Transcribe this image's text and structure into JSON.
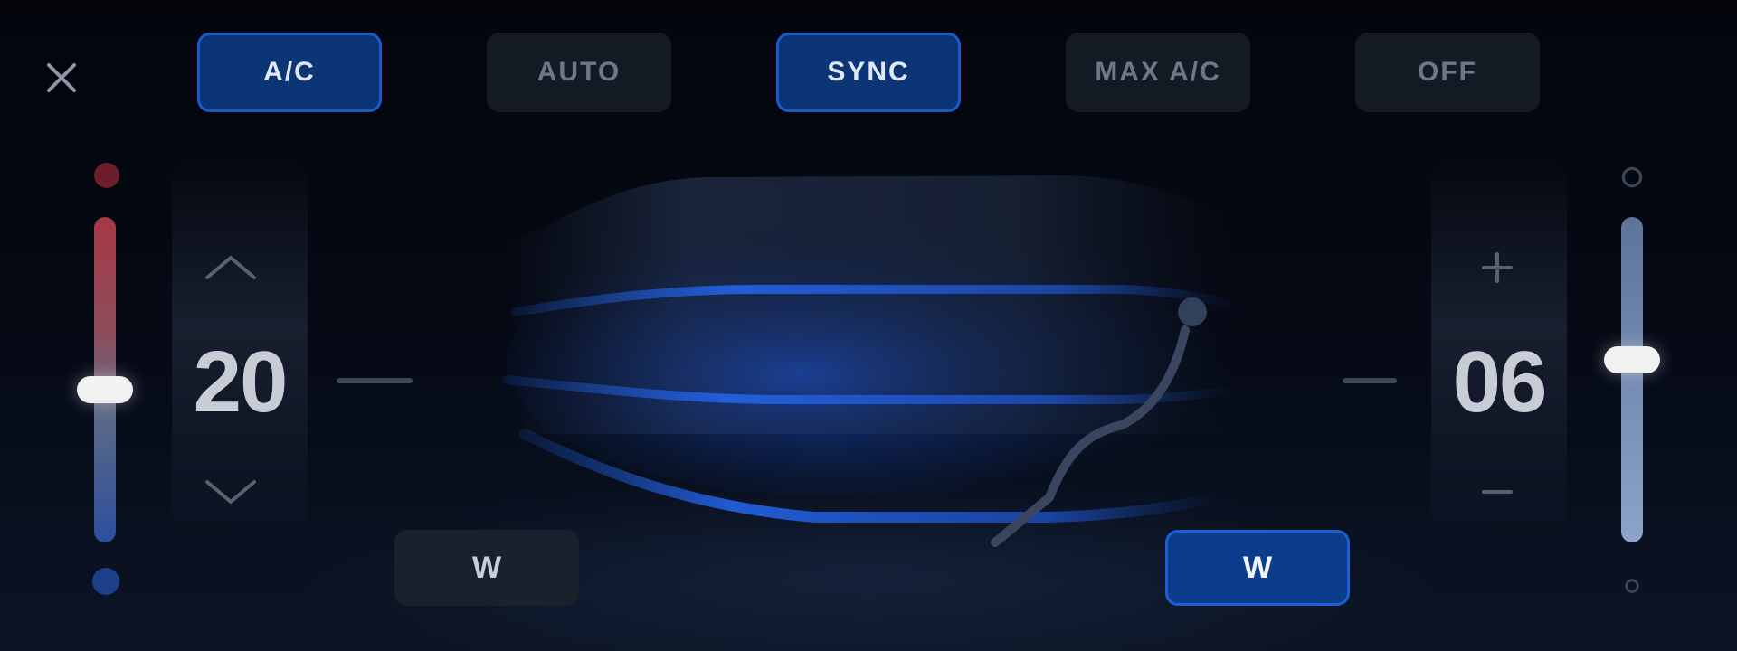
{
  "toolbar": {
    "close_icon": "close-icon",
    "modes": [
      {
        "id": "ac",
        "label": "A/C",
        "active": true
      },
      {
        "id": "auto",
        "label": "AUTO",
        "active": false
      },
      {
        "id": "sync",
        "label": "SYNC",
        "active": true
      },
      {
        "id": "max_ac",
        "label": "MAX A/C",
        "active": false
      },
      {
        "id": "off",
        "label": "OFF",
        "active": false
      }
    ]
  },
  "temperature": {
    "value": "20",
    "heat_icon": "heat-dot-icon",
    "cool_icon": "cool-dot-icon",
    "up_icon": "chevron-up-icon",
    "down_icon": "chevron-down-icon",
    "slider_level": 0.47
  },
  "fan": {
    "value": "06",
    "plus_icon": "plus-icon",
    "minus_icon": "minus-icon",
    "slider_level": 0.56
  },
  "airflow": {
    "icon": "airflow-visual",
    "seat_icon": "seat-occupant-icon"
  },
  "zones": [
    {
      "id": "zone_left",
      "label": "W",
      "active": false
    },
    {
      "id": "zone_right",
      "label": "W",
      "active": true
    }
  ],
  "colors": {
    "accent": "#1d58c8",
    "active_fill": "#0c3576",
    "heat": "#a83846",
    "cool": "#2d4f9e"
  }
}
